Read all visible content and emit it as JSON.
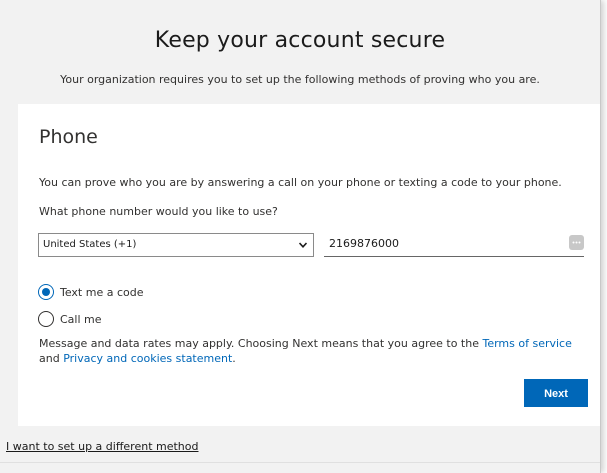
{
  "header": {
    "title": "Keep your account secure",
    "subtitle": "Your organization requires you to set up the following methods of proving who you are."
  },
  "card": {
    "title": "Phone",
    "description": "You can prove who you are by answering a call on your phone or texting a code to your phone.",
    "question": "What phone number would you like to use?",
    "country_select": {
      "value": "United States (+1)"
    },
    "phone_input": {
      "value": "2169876000"
    },
    "radios": [
      {
        "label": "Text me a code",
        "checked": true
      },
      {
        "label": "Call me",
        "checked": false
      }
    ],
    "notice": {
      "prefix": "Message and data rates may apply. Choosing Next means that you agree to the ",
      "terms_link": "Terms of service",
      "middle": " and ",
      "privacy_link": "Privacy and cookies statement",
      "suffix": "."
    },
    "next_button": "Next"
  },
  "footer": {
    "link": "I want to set up a different method"
  },
  "colors": {
    "accent": "#0067b8",
    "background": "#f2f2f2",
    "card": "#ffffff"
  }
}
